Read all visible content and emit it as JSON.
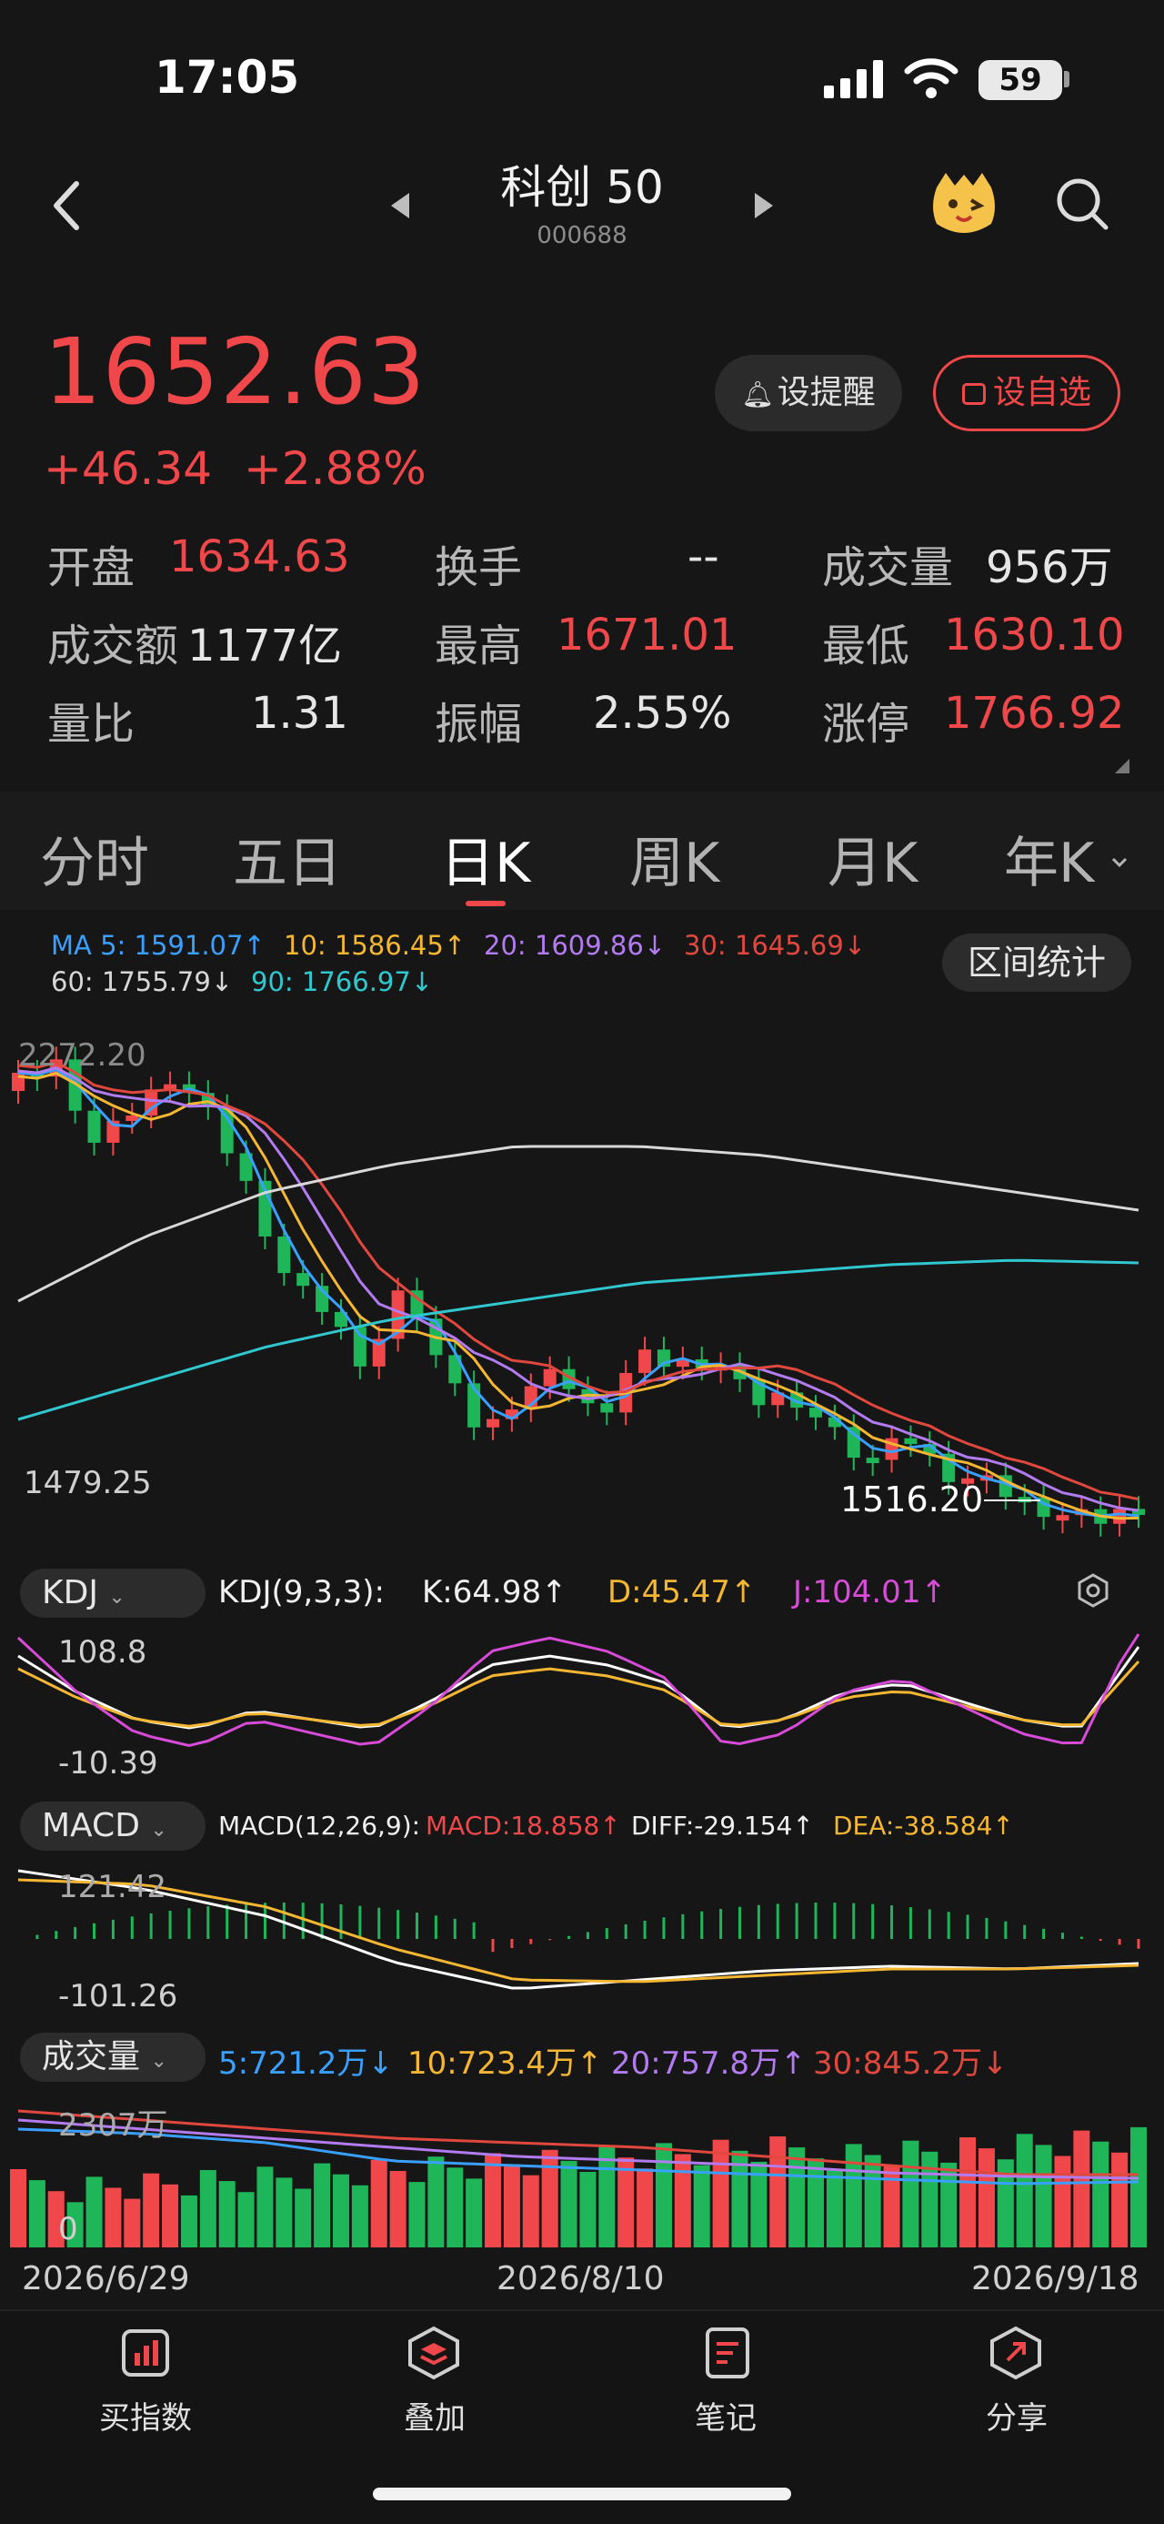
{
  "status": {
    "time": "17:05",
    "battery": "59"
  },
  "nav": {
    "title": "科创 50",
    "code": "000688"
  },
  "quote": {
    "price": "1652.63",
    "change": "+46.34",
    "change_pct": "+2.88%",
    "alert_label": "设提醒",
    "watch_label": "设自选"
  },
  "stats": [
    {
      "label": "开盘",
      "value": "1634.63"
    },
    {
      "label": "换手",
      "value": "--"
    },
    {
      "label": "成交量",
      "value": "956万"
    },
    {
      "label": "成交额",
      "value": "1177亿"
    },
    {
      "label": "最高",
      "value": "1671.01"
    },
    {
      "label": "最低",
      "value": "1630.10"
    },
    {
      "label": "量比",
      "value": "1.31"
    },
    {
      "label": "振幅",
      "value": "2.55%"
    },
    {
      "label": "涨停",
      "value": "1766.92"
    }
  ],
  "tabs": [
    "分时",
    "五日",
    "日K",
    "周K",
    "月K",
    "年K"
  ],
  "ma_legend": {
    "ma5": "MA 5: 1591.07↑",
    "ma10": "10: 1586.45↑",
    "ma20": "20: 1609.86↓",
    "ma30": "30: 1645.69↓",
    "ma60": "60: 1755.79↓",
    "ma90": "90: 1766.97↓",
    "range_stats": "区间统计"
  },
  "kline": {
    "high_label": "2272.20",
    "low_label": "1479.25",
    "min_marker": "1516.20"
  },
  "kdj": {
    "selector": "KDJ",
    "params": "KDJ(9,3,3):",
    "k": "K:64.98↑",
    "d": "D:45.47↑",
    "j": "J:104.01↑",
    "top": "108.8",
    "bottom": "-10.39"
  },
  "macd": {
    "selector": "MACD",
    "params": "MACD(12,26,9):",
    "macd": "MACD:18.858↑",
    "diff": "DIFF:-29.154↑",
    "dea": "DEA:-38.584↑",
    "top": "121.42",
    "bottom": "-101.26"
  },
  "volume": {
    "selector": "成交量",
    "v5": "5:721.2万↓",
    "v10": "10:723.4万↑",
    "v20": "20:757.8万↑",
    "v30": "30:845.2万↓",
    "top": "2307万",
    "bottom": "0"
  },
  "dates": [
    "2026/6/29",
    "2026/8/10",
    "2026/9/18"
  ],
  "bottom_nav": [
    "买指数",
    "叠加",
    "笔记",
    "分享"
  ],
  "colors": {
    "up": "#f0474a",
    "down": "#1fb65a",
    "ma5": "#3aa0ff",
    "ma10": "#f5b732",
    "ma20": "#b27bf0",
    "ma30": "#e0483e",
    "ma60": "#d8d8d8",
    "ma90": "#30c7cf"
  }
}
